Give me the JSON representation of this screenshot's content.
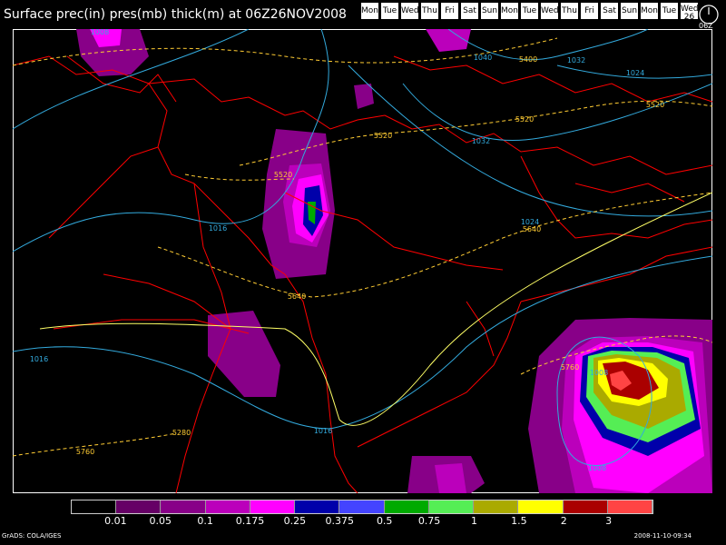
{
  "title": "Surface prec(in) pres(mb) thick(m) at 06Z26NOV2008",
  "days": [
    "Mon",
    "Tue",
    "Wed",
    "Thu",
    "Fri",
    "Sat",
    "Sun",
    "Mon",
    "Tue",
    "Wed",
    "Thu",
    "Fri",
    "Sat",
    "Sun",
    "Mon",
    "Tue",
    "Wed"
  ],
  "current_day_number": "26",
  "clock_label": "06Z",
  "contour_labels": {
    "pressure": [
      "1008",
      "1040",
      "1032",
      "1024",
      "1032",
      "1024",
      "1016",
      "1016",
      "1016",
      "1008",
      "1008"
    ],
    "thickness": [
      "5400",
      "5520",
      "5520",
      "5520",
      "5520",
      "5640",
      "5640",
      "5280",
      "5760",
      "5760"
    ]
  },
  "legend": {
    "colors": [
      "#000000",
      "#660066",
      "#880088",
      "#bb00bb",
      "#ff00ff",
      "#0000aa",
      "#4444ff",
      "#00aa00",
      "#55ee55",
      "#aaaa00",
      "#ffff00",
      "#aa0000",
      "#ff4444"
    ],
    "labels": [
      "0.01",
      "0.05",
      "0.1",
      "0.175",
      "0.25",
      "0.375",
      "0.5",
      "0.75",
      "1",
      "1.5",
      "2",
      "3"
    ]
  },
  "footer": {
    "credit": "GrADS: COLA/IGES",
    "timestamp": "2008-11-10-09:34"
  },
  "colors": {
    "coast": "#ff0000",
    "pressure_contour": "#33aadd",
    "thickness_contour": "#ffcc33",
    "frame": "#ffffff"
  }
}
